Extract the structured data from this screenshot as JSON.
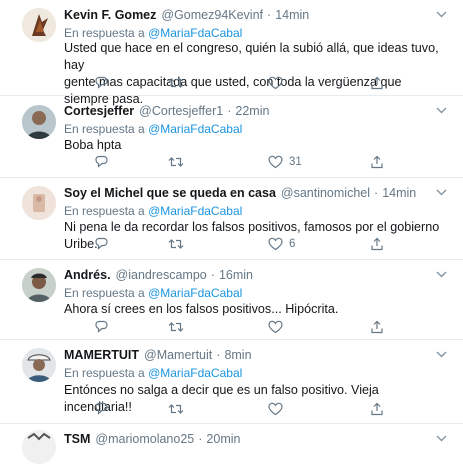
{
  "reply_prefix": "En respuesta a",
  "tweets": [
    {
      "name": "Kevin F. Gomez",
      "handle": "@Gomez94Kevinf",
      "dot": "·",
      "time": "14min",
      "reply_to": "@MariaFdaCabal",
      "text_lines": [
        "Usted que hace en el congreso, quién la subió allá, que ideas tuvo, hay",
        "gente mas capacitada que usted, con toda la vergüenza que siempre pasa."
      ],
      "reply_count": "",
      "retweet_count": "",
      "like_count": ""
    },
    {
      "name": "Cortesjeffer",
      "handle": "@Cortesjeffer1",
      "dot": "·",
      "time": "22min",
      "reply_to": "@MariaFdaCabal",
      "text_lines": [
        "Boba hpta"
      ],
      "reply_count": "",
      "retweet_count": "",
      "like_count": "31"
    },
    {
      "name": "Soy el Michel que se queda en casa",
      "handle": "@santinomichel",
      "dot": "·",
      "time": "14min",
      "reply_to": "@MariaFdaCabal",
      "text_lines": [
        "Ni pena le da recordar los falsos positivos, famosos por el gobierno Uribe."
      ],
      "reply_count": "",
      "retweet_count": "",
      "like_count": "6"
    },
    {
      "name": "Andrés.",
      "handle": "@iandrescampo",
      "dot": "·",
      "time": "16min",
      "reply_to": "@MariaFdaCabal",
      "text_lines": [
        "Ahora sí crees en los falsos positivos... Hipócrita."
      ],
      "reply_count": "",
      "retweet_count": "",
      "like_count": ""
    },
    {
      "name": "MAMERTUIT",
      "handle": "@Mamertuit",
      "dot": "·",
      "time": "8min",
      "reply_to": "@MariaFdaCabal",
      "text_lines": [
        "Entónces no salga a decir que es un falso positivo. Vieja incendiaria!!"
      ],
      "reply_count": "",
      "retweet_count": "",
      "like_count": ""
    },
    {
      "name": "TSM",
      "handle": "@mariomolano25",
      "dot": "·",
      "time": "20min",
      "reply_to": "",
      "text_lines": [],
      "reply_count": "",
      "retweet_count": "",
      "like_count": ""
    }
  ],
  "icons": {
    "reply": "reply-icon",
    "retweet": "retweet-icon",
    "like": "heart-icon",
    "share": "share-icon",
    "more": "chevron-down-icon"
  },
  "colors": {
    "link": "#1b95e0",
    "secondary": "#657786",
    "border": "#e6ecf0"
  }
}
